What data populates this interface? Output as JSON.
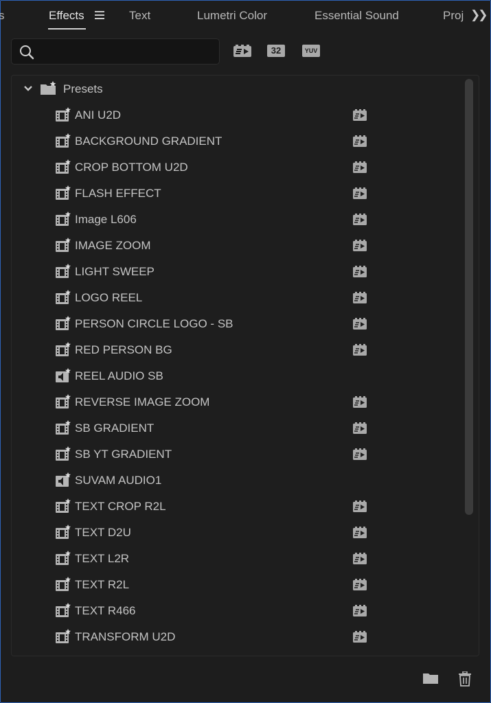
{
  "tabs": [
    {
      "label": "s"
    },
    {
      "label": "Effects"
    },
    {
      "label": "Text"
    },
    {
      "label": "Lumetri Color"
    },
    {
      "label": "Essential Sound"
    },
    {
      "label": "Proj"
    }
  ],
  "search": {
    "value": "",
    "placeholder": ""
  },
  "filters": {
    "accelerated_icon": "accelerated-effects-icon",
    "bit32_label": "32",
    "yuv_label": "YUV"
  },
  "tree": {
    "folder_label": "Presets",
    "items": [
      {
        "label": "ANI U2D",
        "type": "video",
        "accelerated": true
      },
      {
        "label": "BACKGROUND GRADIENT",
        "type": "video",
        "accelerated": true
      },
      {
        "label": "CROP BOTTOM U2D",
        "type": "video",
        "accelerated": true
      },
      {
        "label": "FLASH EFFECT",
        "type": "video",
        "accelerated": true
      },
      {
        "label": "Image L606",
        "type": "video",
        "accelerated": true
      },
      {
        "label": "IMAGE ZOOM",
        "type": "video",
        "accelerated": true
      },
      {
        "label": "LIGHT SWEEP",
        "type": "video",
        "accelerated": true
      },
      {
        "label": "LOGO REEL",
        "type": "video",
        "accelerated": true
      },
      {
        "label": "PERSON CIRCLE LOGO - SB",
        "type": "video",
        "accelerated": true
      },
      {
        "label": "RED PERSON BG",
        "type": "video",
        "accelerated": true
      },
      {
        "label": "REEL AUDIO SB",
        "type": "audio",
        "accelerated": false
      },
      {
        "label": "REVERSE IMAGE ZOOM",
        "type": "video",
        "accelerated": true
      },
      {
        "label": "SB GRADIENT",
        "type": "video",
        "accelerated": true
      },
      {
        "label": "SB YT GRADIENT",
        "type": "video",
        "accelerated": true
      },
      {
        "label": "SUVAM AUDIO1",
        "type": "audio",
        "accelerated": false
      },
      {
        "label": "TEXT CROP R2L",
        "type": "video",
        "accelerated": true
      },
      {
        "label": "TEXT D2U",
        "type": "video",
        "accelerated": true
      },
      {
        "label": "TEXT L2R",
        "type": "video",
        "accelerated": true
      },
      {
        "label": "TEXT R2L",
        "type": "video",
        "accelerated": true
      },
      {
        "label": "TEXT R466",
        "type": "video",
        "accelerated": true
      },
      {
        "label": "TRANSFORM U2D",
        "type": "video",
        "accelerated": true
      }
    ]
  },
  "colors": {
    "background": "#1d1d1d",
    "accent_border": "#2e63b8",
    "text": "#c4c4c4"
  }
}
